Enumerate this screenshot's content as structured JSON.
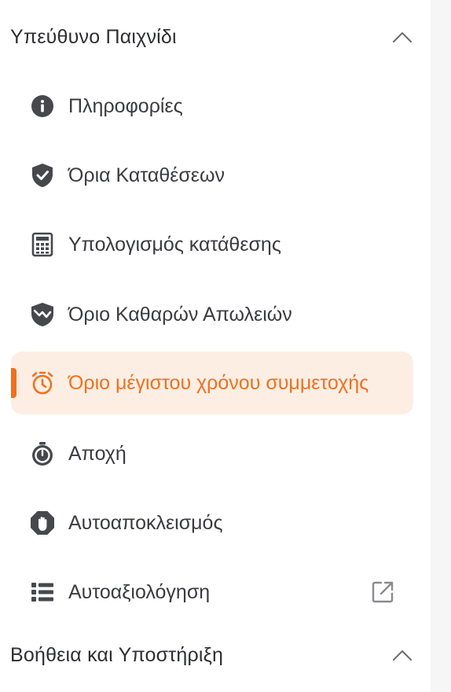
{
  "sections": [
    {
      "title": "Υπεύθυνο Παιχνίδι",
      "chevron_icon": "chevron-up-icon",
      "items": [
        {
          "label": "Πληροφορίες",
          "icon": "info-icon"
        },
        {
          "label": "Όρια Καταθέσεων",
          "icon": "shield-check-icon"
        },
        {
          "label": "Υπολογισμός κατάθεσης",
          "icon": "calculator-icon"
        },
        {
          "label": "Όριο Καθαρών Απωλειών",
          "icon": "shield-chart-icon"
        },
        {
          "label": "Όριο μέγιστου χρόνου συμμετοχής",
          "icon": "stopwatch-icon",
          "active": true
        },
        {
          "label": "Αποχή",
          "icon": "timer-icon"
        },
        {
          "label": "Αυτοαποκλεισμός",
          "icon": "hand-stop-icon"
        },
        {
          "label": "Αυτοαξιολόγηση",
          "icon": "list-icon",
          "trailing_icon": "external-link-icon"
        }
      ]
    },
    {
      "title": "Βοήθεια και Υποστήριξη",
      "chevron_icon": "chevron-up-icon"
    }
  ],
  "colors": {
    "accent": "#f0701e",
    "active_background": "#fdeee4",
    "text": "#3b3c40",
    "icon": "#47484c"
  }
}
